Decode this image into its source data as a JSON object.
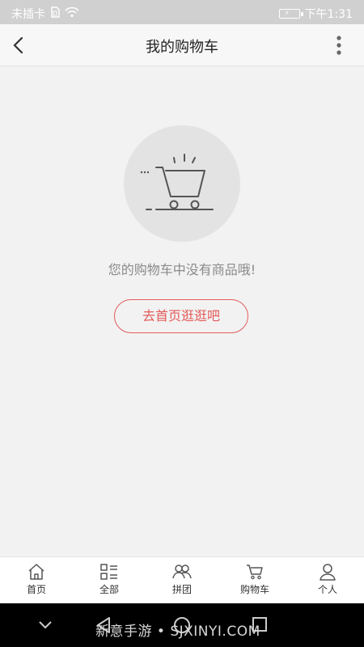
{
  "status_bar": {
    "carrier": "未插卡",
    "time": "下午1:31"
  },
  "header": {
    "title": "我的购物车"
  },
  "empty_state": {
    "message": "您的购物车中没有商品哦!",
    "button_label": "去首页逛逛吧"
  },
  "tabbar": {
    "items": [
      {
        "label": "首页",
        "icon": "home-icon"
      },
      {
        "label": "全部",
        "icon": "category-list-icon"
      },
      {
        "label": "拼团",
        "icon": "group-buy-icon"
      },
      {
        "label": "购物车",
        "icon": "cart-icon"
      },
      {
        "label": "个人",
        "icon": "user-icon"
      }
    ]
  },
  "watermark": "新意手游 • SJXINYI.COM",
  "colors": {
    "accent": "#e45b5b",
    "status_bar": "#d0d0d0",
    "background": "#f2f2f2"
  }
}
